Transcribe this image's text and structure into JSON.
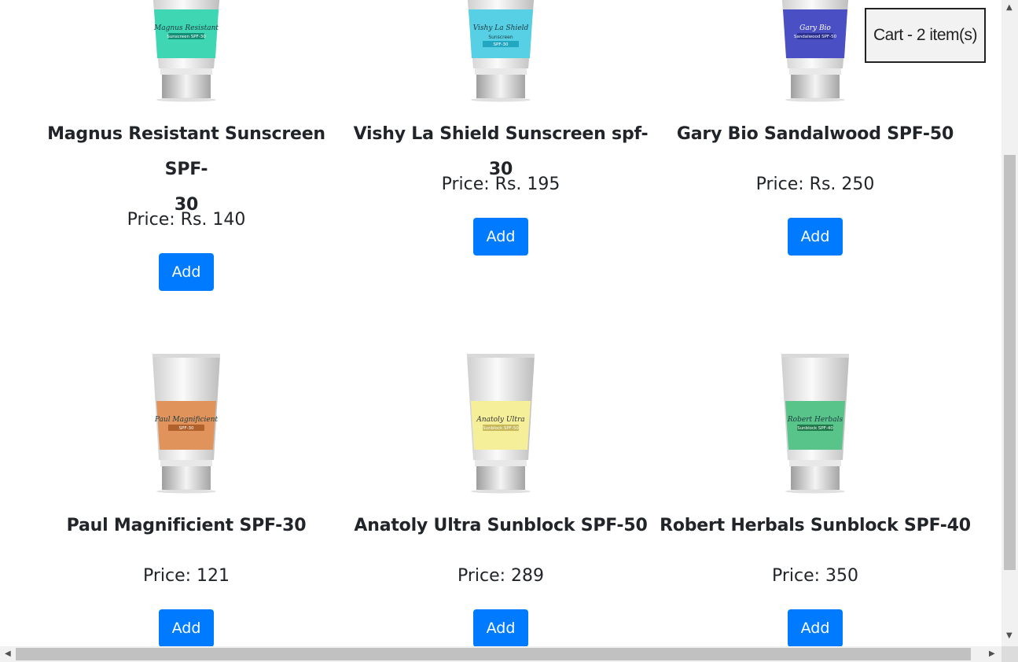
{
  "cart": {
    "label": "Cart - 2 item(s)"
  },
  "add_label": "Add",
  "products": [
    {
      "name_line1": "Magnus Resistant Sunscreen SPF-",
      "name_line2": "30",
      "price": "Price: Rs. 140",
      "tube": {
        "band_color": "#3fd6b4",
        "brand": "Magnus Resistant",
        "tag": "Sunscreen SPF-30",
        "tag_color": "#138f77"
      }
    },
    {
      "name": "Vishy La Shield Sunscreen spf-30",
      "price": "Price: Rs. 195",
      "tube": {
        "band_color": "#57cfe4",
        "brand": "Vishy La Shield",
        "sub": "Sunscreen",
        "tag": "SPF-30",
        "tag_color": "#23a7c1"
      }
    },
    {
      "name": "Gary Bio Sandalwood SPF-50",
      "price": "Price: Rs. 250",
      "tube": {
        "band_color": "#4a4fc4",
        "brand": "Gary Bio",
        "tag": "Sandalwood SPF-50",
        "tag_color": "#2c308f"
      }
    },
    {
      "name": "Paul Magnificient SPF-30",
      "price": "Price: 121",
      "tube": {
        "band_color": "#e0935a",
        "brand": "Paul Magnificient",
        "tag": "SPF-30",
        "tag_color": "#b0602a"
      }
    },
    {
      "name": "Anatoly Ultra Sunblock SPF-50",
      "price": "Price: 289",
      "tube": {
        "band_color": "#f6ef9a",
        "brand": "Anatoly Ultra",
        "tag": "Sunblock SPF-50",
        "tag_color": "#c7b85a"
      }
    },
    {
      "name": "Robert Herbals Sunblock SPF-40",
      "price": "Price: 350",
      "tube": {
        "band_color": "#58c48a",
        "brand": "Robert Herbals",
        "tag": "Sunblock SPF-40",
        "tag_color": "#1f7a49"
      }
    }
  ]
}
